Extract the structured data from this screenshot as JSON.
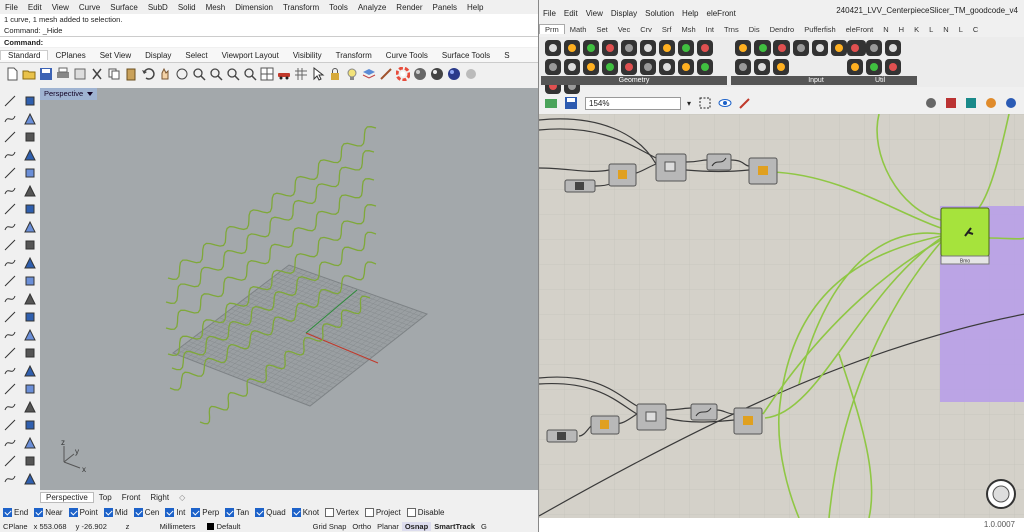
{
  "rhino": {
    "menu": [
      "File",
      "Edit",
      "View",
      "Curve",
      "Surface",
      "SubD",
      "Solid",
      "Mesh",
      "Dimension",
      "Transform",
      "Tools",
      "Analyze",
      "Render",
      "Panels",
      "Help"
    ],
    "command_history": [
      "1 curve, 1 mesh added to selection.",
      "Command: _Hide"
    ],
    "command_prompt": "Command:",
    "toolbar_tabs": [
      "Standard",
      "CPlanes",
      "Set View",
      "Display",
      "Select",
      "Viewport Layout",
      "Visibility",
      "Transform",
      "Curve Tools",
      "Surface Tools",
      "S"
    ],
    "viewport_title": "Perspective",
    "viewport_tabs": [
      "Perspective",
      "Top",
      "Front",
      "Right"
    ],
    "osnaps": [
      {
        "label": "End",
        "on": true
      },
      {
        "label": "Near",
        "on": true
      },
      {
        "label": "Point",
        "on": true
      },
      {
        "label": "Mid",
        "on": true
      },
      {
        "label": "Cen",
        "on": true
      },
      {
        "label": "Int",
        "on": true
      },
      {
        "label": "Perp",
        "on": true
      },
      {
        "label": "Tan",
        "on": true
      },
      {
        "label": "Quad",
        "on": true
      },
      {
        "label": "Knot",
        "on": true
      },
      {
        "label": "Vertex",
        "on": false
      },
      {
        "label": "Project",
        "on": false
      },
      {
        "label": "Disable",
        "on": false
      }
    ],
    "status": {
      "cplane": "CPlane",
      "x": "x 553.068",
      "y": "y -26.902",
      "z": "z",
      "units": "Millimeters",
      "layer": "Default",
      "toggles": [
        "Grid Snap",
        "Ortho",
        "Planar",
        "Osnap",
        "SmartTrack",
        "G"
      ]
    },
    "axis_labels": [
      "x",
      "y",
      "z"
    ],
    "colors": {
      "viewport_bg": "#a3a8ab",
      "curve": "#7fa83a",
      "grid": "#8a8e90",
      "x_axis": "#c0392b",
      "y_axis": "#2e8b3a"
    }
  },
  "gh": {
    "menu": [
      "File",
      "Edit",
      "View",
      "Display",
      "Solution",
      "Help",
      "eleFront"
    ],
    "title": "240421_LVV_CenterpieceSlicer_TM_goodcode_v4",
    "tabs": [
      "Prm",
      "Math",
      "Set",
      "Vec",
      "Crv",
      "Srf",
      "Msh",
      "Int",
      "Trns",
      "Dis",
      "Dendro",
      "Pufferfish",
      "eleFront",
      "N",
      "H",
      "K",
      "L",
      "N",
      "L",
      "C"
    ],
    "ribbon_groups": [
      "Geometry",
      "Primitive",
      "Input",
      "Util"
    ],
    "zoom": "154%",
    "status_value": "1.0.0007",
    "cluster_label": "Bmo",
    "colors": {
      "canvas": "#d4d1c9",
      "wire_green": "#8fc744",
      "wire_dark": "#3a3a3a",
      "group": "#b89ee8",
      "component_green": "#a6e33c"
    }
  }
}
